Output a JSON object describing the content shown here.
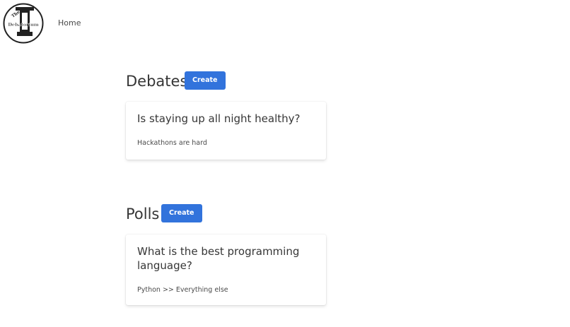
{
  "nav": {
    "logo_text_top": "The",
    "logo_text_bottom": "Debatorium",
    "home_label": "Home"
  },
  "debates": {
    "title": "Debates",
    "create_label": "Create",
    "cards": [
      {
        "title": "Is staying up all night healthy?",
        "description": "Hackathons are hard"
      }
    ]
  },
  "polls": {
    "title": "Polls",
    "create_label": "Create",
    "cards": [
      {
        "title": "What is the best programming language?",
        "description": "Python >> Everything else"
      }
    ]
  },
  "colors": {
    "primary": "#3273dc",
    "text": "#363636"
  }
}
